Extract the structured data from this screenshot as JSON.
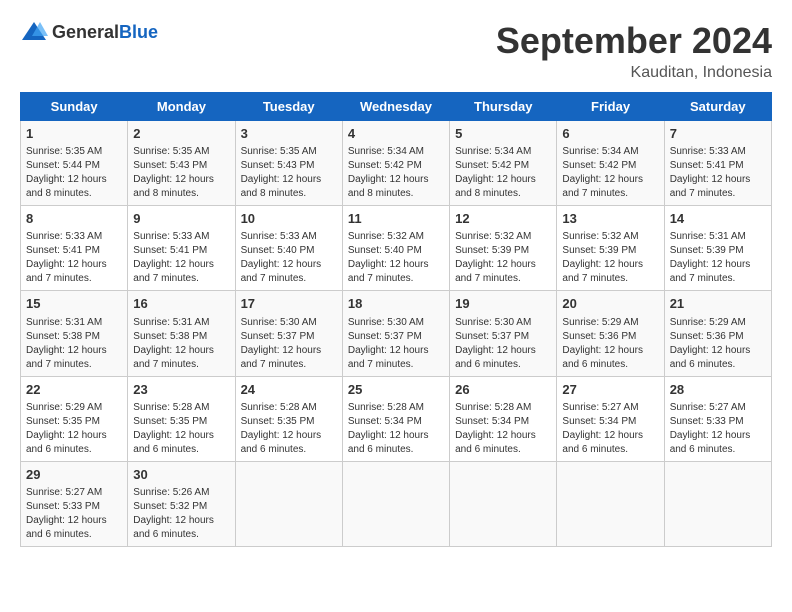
{
  "header": {
    "logo_general": "General",
    "logo_blue": "Blue",
    "title": "September 2024",
    "subtitle": "Kauditan, Indonesia"
  },
  "columns": [
    "Sunday",
    "Monday",
    "Tuesday",
    "Wednesday",
    "Thursday",
    "Friday",
    "Saturday"
  ],
  "weeks": [
    [
      {
        "day": "1",
        "lines": [
          "Sunrise: 5:35 AM",
          "Sunset: 5:44 PM",
          "Daylight: 12 hours",
          "and 8 minutes."
        ]
      },
      {
        "day": "2",
        "lines": [
          "Sunrise: 5:35 AM",
          "Sunset: 5:43 PM",
          "Daylight: 12 hours",
          "and 8 minutes."
        ]
      },
      {
        "day": "3",
        "lines": [
          "Sunrise: 5:35 AM",
          "Sunset: 5:43 PM",
          "Daylight: 12 hours",
          "and 8 minutes."
        ]
      },
      {
        "day": "4",
        "lines": [
          "Sunrise: 5:34 AM",
          "Sunset: 5:42 PM",
          "Daylight: 12 hours",
          "and 8 minutes."
        ]
      },
      {
        "day": "5",
        "lines": [
          "Sunrise: 5:34 AM",
          "Sunset: 5:42 PM",
          "Daylight: 12 hours",
          "and 8 minutes."
        ]
      },
      {
        "day": "6",
        "lines": [
          "Sunrise: 5:34 AM",
          "Sunset: 5:42 PM",
          "Daylight: 12 hours",
          "and 7 minutes."
        ]
      },
      {
        "day": "7",
        "lines": [
          "Sunrise: 5:33 AM",
          "Sunset: 5:41 PM",
          "Daylight: 12 hours",
          "and 7 minutes."
        ]
      }
    ],
    [
      {
        "day": "8",
        "lines": [
          "Sunrise: 5:33 AM",
          "Sunset: 5:41 PM",
          "Daylight: 12 hours",
          "and 7 minutes."
        ]
      },
      {
        "day": "9",
        "lines": [
          "Sunrise: 5:33 AM",
          "Sunset: 5:41 PM",
          "Daylight: 12 hours",
          "and 7 minutes."
        ]
      },
      {
        "day": "10",
        "lines": [
          "Sunrise: 5:33 AM",
          "Sunset: 5:40 PM",
          "Daylight: 12 hours",
          "and 7 minutes."
        ]
      },
      {
        "day": "11",
        "lines": [
          "Sunrise: 5:32 AM",
          "Sunset: 5:40 PM",
          "Daylight: 12 hours",
          "and 7 minutes."
        ]
      },
      {
        "day": "12",
        "lines": [
          "Sunrise: 5:32 AM",
          "Sunset: 5:39 PM",
          "Daylight: 12 hours",
          "and 7 minutes."
        ]
      },
      {
        "day": "13",
        "lines": [
          "Sunrise: 5:32 AM",
          "Sunset: 5:39 PM",
          "Daylight: 12 hours",
          "and 7 minutes."
        ]
      },
      {
        "day": "14",
        "lines": [
          "Sunrise: 5:31 AM",
          "Sunset: 5:39 PM",
          "Daylight: 12 hours",
          "and 7 minutes."
        ]
      }
    ],
    [
      {
        "day": "15",
        "lines": [
          "Sunrise: 5:31 AM",
          "Sunset: 5:38 PM",
          "Daylight: 12 hours",
          "and 7 minutes."
        ]
      },
      {
        "day": "16",
        "lines": [
          "Sunrise: 5:31 AM",
          "Sunset: 5:38 PM",
          "Daylight: 12 hours",
          "and 7 minutes."
        ]
      },
      {
        "day": "17",
        "lines": [
          "Sunrise: 5:30 AM",
          "Sunset: 5:37 PM",
          "Daylight: 12 hours",
          "and 7 minutes."
        ]
      },
      {
        "day": "18",
        "lines": [
          "Sunrise: 5:30 AM",
          "Sunset: 5:37 PM",
          "Daylight: 12 hours",
          "and 7 minutes."
        ]
      },
      {
        "day": "19",
        "lines": [
          "Sunrise: 5:30 AM",
          "Sunset: 5:37 PM",
          "Daylight: 12 hours",
          "and 6 minutes."
        ]
      },
      {
        "day": "20",
        "lines": [
          "Sunrise: 5:29 AM",
          "Sunset: 5:36 PM",
          "Daylight: 12 hours",
          "and 6 minutes."
        ]
      },
      {
        "day": "21",
        "lines": [
          "Sunrise: 5:29 AM",
          "Sunset: 5:36 PM",
          "Daylight: 12 hours",
          "and 6 minutes."
        ]
      }
    ],
    [
      {
        "day": "22",
        "lines": [
          "Sunrise: 5:29 AM",
          "Sunset: 5:35 PM",
          "Daylight: 12 hours",
          "and 6 minutes."
        ]
      },
      {
        "day": "23",
        "lines": [
          "Sunrise: 5:28 AM",
          "Sunset: 5:35 PM",
          "Daylight: 12 hours",
          "and 6 minutes."
        ]
      },
      {
        "day": "24",
        "lines": [
          "Sunrise: 5:28 AM",
          "Sunset: 5:35 PM",
          "Daylight: 12 hours",
          "and 6 minutes."
        ]
      },
      {
        "day": "25",
        "lines": [
          "Sunrise: 5:28 AM",
          "Sunset: 5:34 PM",
          "Daylight: 12 hours",
          "and 6 minutes."
        ]
      },
      {
        "day": "26",
        "lines": [
          "Sunrise: 5:28 AM",
          "Sunset: 5:34 PM",
          "Daylight: 12 hours",
          "and 6 minutes."
        ]
      },
      {
        "day": "27",
        "lines": [
          "Sunrise: 5:27 AM",
          "Sunset: 5:34 PM",
          "Daylight: 12 hours",
          "and 6 minutes."
        ]
      },
      {
        "day": "28",
        "lines": [
          "Sunrise: 5:27 AM",
          "Sunset: 5:33 PM",
          "Daylight: 12 hours",
          "and 6 minutes."
        ]
      }
    ],
    [
      {
        "day": "29",
        "lines": [
          "Sunrise: 5:27 AM",
          "Sunset: 5:33 PM",
          "Daylight: 12 hours",
          "and 6 minutes."
        ]
      },
      {
        "day": "30",
        "lines": [
          "Sunrise: 5:26 AM",
          "Sunset: 5:32 PM",
          "Daylight: 12 hours",
          "and 6 minutes."
        ]
      },
      null,
      null,
      null,
      null,
      null
    ]
  ]
}
